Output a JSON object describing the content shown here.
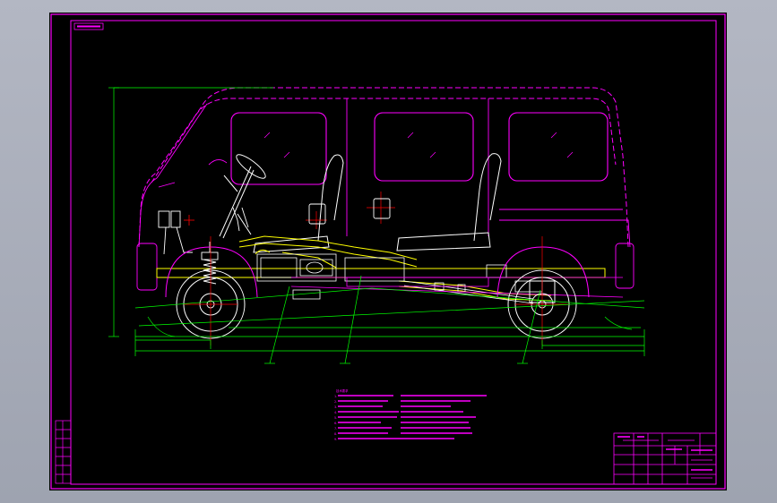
{
  "colors": {
    "background": "#000000",
    "border": "#ff00ff",
    "vehicle_outline": "#ff00ff",
    "chassis": "#ffff00",
    "component": "#ffffff",
    "centerline": "#ff0000",
    "dimension": "#00ff00",
    "viewport": "#a8acb8"
  },
  "drawing": {
    "view": "side-elevation-chassis-assembly",
    "icons": [
      "steering-wheel-icon",
      "seat-icon",
      "wheel-icon",
      "spring-icon",
      "window-icon"
    ]
  },
  "notes": {
    "heading": "技术要求",
    "lines_left": [
      "1. ",
      "2. ",
      "3. ",
      "4. ",
      "5. ",
      "6. ",
      "7. ",
      "8. ",
      "9. "
    ]
  },
  "title_block": {
    "drawing_title": "",
    "drawing_number": ""
  }
}
